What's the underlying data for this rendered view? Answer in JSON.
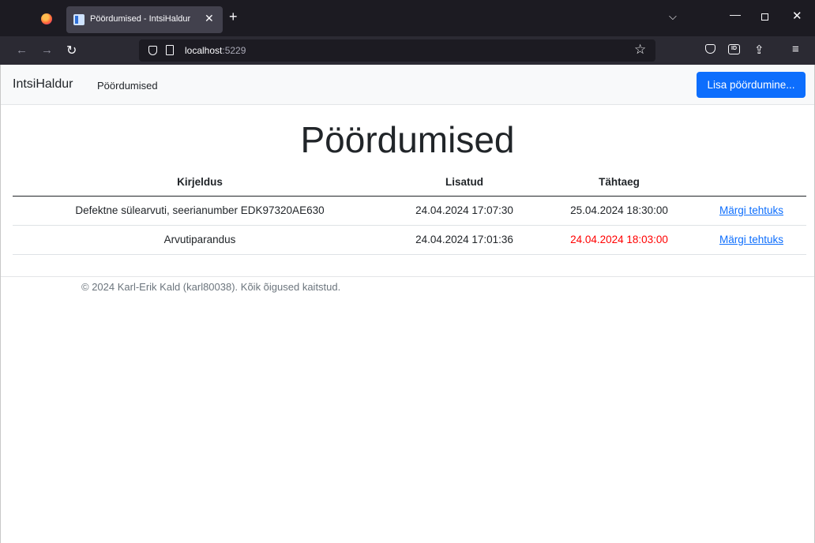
{
  "browser": {
    "tab_title": "Pöördumised - IntsiHaldur",
    "url_host": "localhost",
    "url_port": ":5229"
  },
  "icons": {
    "firefox": "firefox-icon",
    "favicon": "page-favicon-icon",
    "close": "close-icon",
    "new_tab": "plus-icon",
    "tab_list": "chevron-down-icon",
    "back": "arrow-left-icon",
    "forward": "arrow-right-icon",
    "reload": "reload-icon",
    "shield": "shield-icon",
    "page": "page-icon",
    "bookmark": "star-icon",
    "pocket": "pocket-icon",
    "extension": "extension-icon",
    "share": "share-icon",
    "menu": "hamburger-menu-icon"
  },
  "header": {
    "brand": "IntsiHaldur",
    "nav_link": "Pöördumised",
    "add_button": "Lisa pöördumine..."
  },
  "main": {
    "title": "Pöördumised",
    "columns": [
      "Kirjeldus",
      "Lisatud",
      "Tähtaeg",
      ""
    ],
    "rows": [
      {
        "description": "Defektne sülearvuti, seerianumber EDK97320AE630",
        "added": "24.04.2024 17:07:30",
        "deadline": "25.04.2024 18:30:00",
        "overdue": false,
        "action": "Märgi tehtuks"
      },
      {
        "description": "Arvutiparandus",
        "added": "24.04.2024 17:01:36",
        "deadline": "24.04.2024 18:03:00",
        "overdue": true,
        "action": "Märgi tehtuks"
      }
    ]
  },
  "colors": {
    "primary": "#0d6efd",
    "overdue": "#ff0000",
    "text": "#212529",
    "muted": "#6c757d"
  },
  "footer": {
    "text": "© 2024 Karl-Erik Kald (karl80038). Kõik õigused kaitstud."
  }
}
